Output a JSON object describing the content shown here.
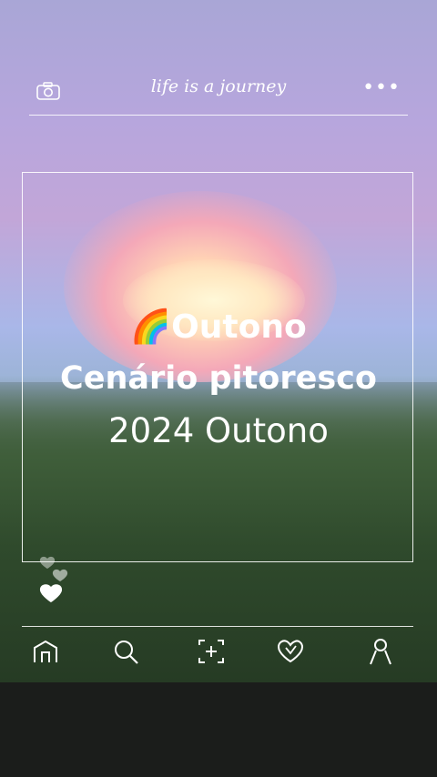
{
  "header": {
    "title": "life is a journey",
    "left_icon": "camera-icon",
    "right_icon": "more-dots-icon"
  },
  "caption": {
    "line1_emoji": "🌈",
    "line1_text": "Outono",
    "line2": "Cenário pitoresco",
    "line3": "2024 Outono"
  },
  "nav": {
    "items": [
      "home-icon",
      "search-icon",
      "add-frame-icon",
      "heart-icon",
      "profile-icon"
    ]
  },
  "colors": {
    "line": "#ffffff",
    "sky_pink": "#f4a8b8",
    "sky_lilac": "#b7a6dd",
    "foliage": "#2f4a2c"
  }
}
